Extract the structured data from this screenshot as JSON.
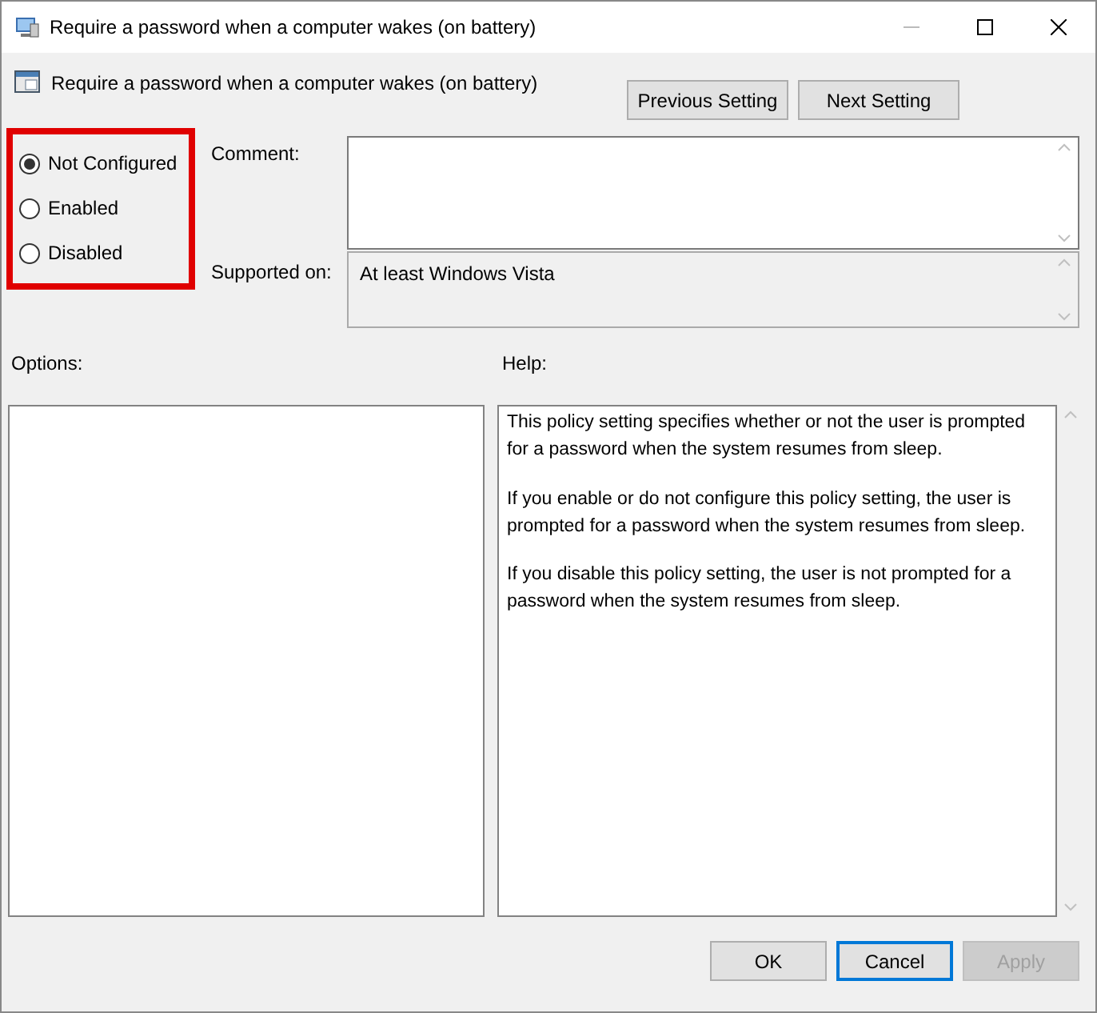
{
  "window": {
    "title": "Require a password when a computer wakes (on battery)"
  },
  "header": {
    "title": "Require a password when a computer wakes (on battery)"
  },
  "nav_buttons": [
    {
      "label": "Previous Setting"
    },
    {
      "label": "Next Setting"
    }
  ],
  "state_options": {
    "highlighted": true,
    "items": [
      {
        "label": "Not Configured",
        "selected": true
      },
      {
        "label": "Enabled",
        "selected": false
      },
      {
        "label": "Disabled",
        "selected": false
      }
    ]
  },
  "comment": {
    "label": "Comment:"
  },
  "supported_on": {
    "label": "Supported on:",
    "value": "At least Windows Vista"
  },
  "options": {
    "label": "Options:"
  },
  "help": {
    "label": "Help:",
    "paragraphs": [
      "This policy setting specifies whether or not the user is prompted for a password when the system resumes from sleep.",
      "If you enable or do not configure this policy setting, the user is prompted for a password when the system resumes from sleep.",
      "If you disable this policy setting, the user is not prompted for a password when the system resumes from sleep."
    ]
  },
  "buttons": [
    {
      "label": "OK",
      "kind": "normal"
    },
    {
      "label": "Cancel",
      "kind": "default"
    },
    {
      "label": "Apply",
      "kind": "disabled"
    }
  ]
}
